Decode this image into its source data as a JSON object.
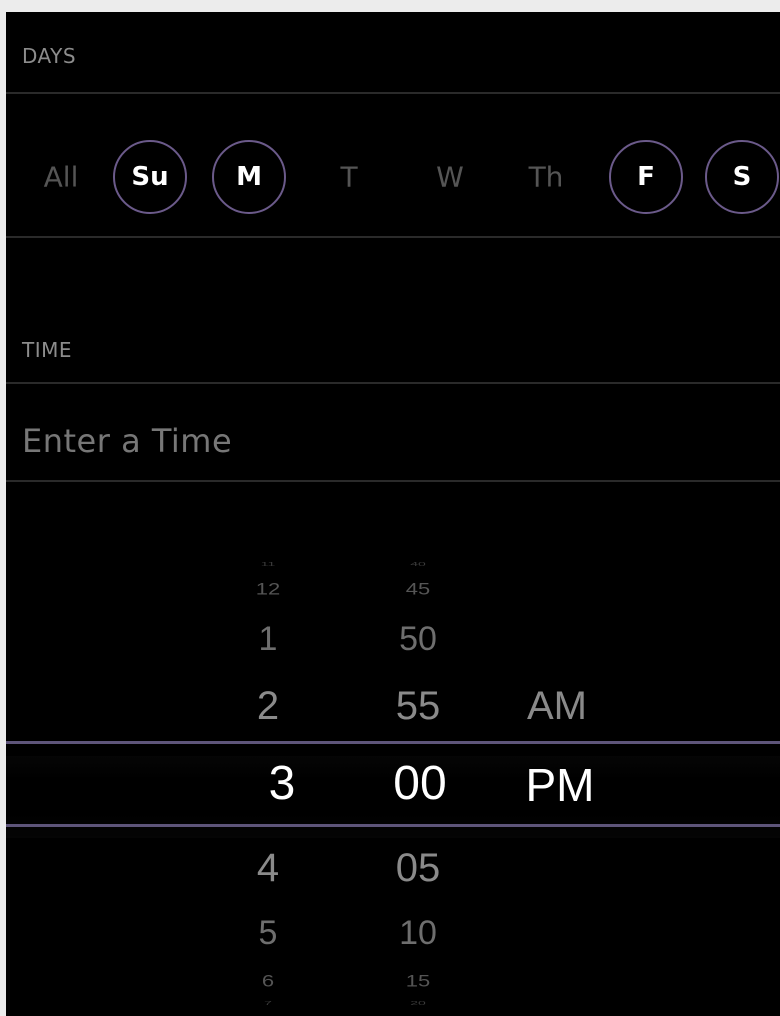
{
  "days_section": {
    "label": "DAYS",
    "all_label": "All",
    "days": [
      {
        "label": "Su",
        "selected": true
      },
      {
        "label": "M",
        "selected": true
      },
      {
        "label": "T",
        "selected": false
      },
      {
        "label": "W",
        "selected": false
      },
      {
        "label": "Th",
        "selected": false
      },
      {
        "label": "F",
        "selected": true
      },
      {
        "label": "S",
        "selected": true
      }
    ]
  },
  "time_section": {
    "label": "TIME",
    "placeholder": "Enter a Time"
  },
  "picker": {
    "hours": [
      "11",
      "12",
      "1",
      "2",
      "3",
      "4",
      "5",
      "6",
      "7"
    ],
    "minutes": [
      "40",
      "45",
      "50",
      "55",
      "00",
      "05",
      "10",
      "15",
      "20"
    ],
    "meridiem": [
      "AM",
      "PM"
    ],
    "selected": {
      "hour": "3",
      "minute": "00",
      "meridiem": "PM"
    }
  },
  "colors": {
    "background": "#000000",
    "selection_ring": "#6b5a8a",
    "selection_line": "#5e557a",
    "muted_text": "#8c8c8c"
  }
}
